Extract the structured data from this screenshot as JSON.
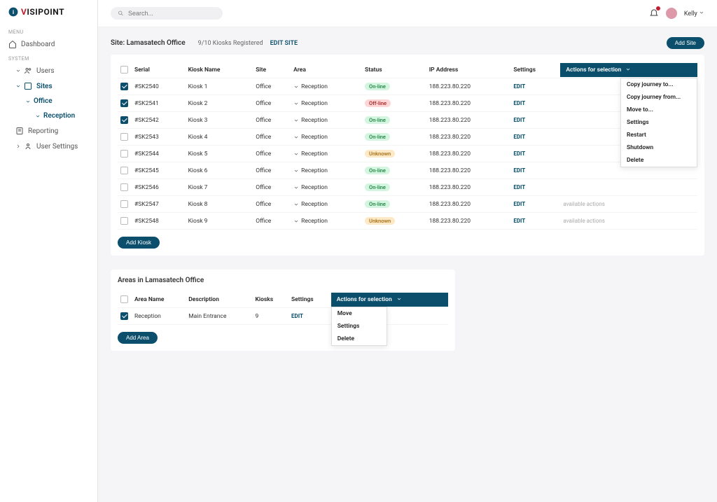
{
  "brand": {
    "v": "V",
    "rest": "ISIPOINT"
  },
  "topbar": {
    "search_placeholder": "Search...",
    "user_name": "Kelly"
  },
  "sidebar": {
    "menu_label": "MENU",
    "system_label": "SYSTEM",
    "dashboard": "Dashboard",
    "users": "Users",
    "sites": "Sites",
    "office": "Office",
    "reception": "Reception",
    "reporting": "Reporting",
    "user_settings": "User Settings"
  },
  "site": {
    "name": "Site: Lamasatech Office",
    "kiosk_count": "9/10 Kiosks Registered",
    "edit_site": "EDIT SITE",
    "add_site": "Add Site"
  },
  "kiosk_table": {
    "headers": {
      "serial": "Serial",
      "kiosk_name": "Kiosk Name",
      "site": "Site",
      "area": "Area",
      "status": "Status",
      "ip": "IP Address",
      "settings": "Settings",
      "actions_head": "Actions for selection"
    },
    "rows": [
      {
        "checked": true,
        "serial": "#SK2540",
        "name": "Kiosk 1",
        "site": "Office",
        "area": "Reception",
        "status": "On-line",
        "status_class": "online",
        "ip": "188.223.80.220"
      },
      {
        "checked": true,
        "serial": "#SK2541",
        "name": "Kiosk 2",
        "site": "Office",
        "area": "Reception",
        "status": "Off-line",
        "status_class": "offline",
        "ip": "188.223.80.220"
      },
      {
        "checked": true,
        "serial": "#SK2542",
        "name": "Kiosk 3",
        "site": "Office",
        "area": "Reception",
        "status": "On-line",
        "status_class": "online",
        "ip": "188.223.80.220"
      },
      {
        "checked": false,
        "serial": "#SK2543",
        "name": "Kiosk 4",
        "site": "Office",
        "area": "Reception",
        "status": "On-line",
        "status_class": "online",
        "ip": "188.223.80.220"
      },
      {
        "checked": false,
        "serial": "#SK2544",
        "name": "Kiosk 5",
        "site": "Office",
        "area": "Reception",
        "status": "Unknown",
        "status_class": "unknown",
        "ip": "188.223.80.220"
      },
      {
        "checked": false,
        "serial": "#SK2545",
        "name": "Kiosk 6",
        "site": "Office",
        "area": "Reception",
        "status": "On-line",
        "status_class": "online",
        "ip": "188.223.80.220"
      },
      {
        "checked": false,
        "serial": "#SK2546",
        "name": "Kiosk 7",
        "site": "Office",
        "area": "Reception",
        "status": "On-line",
        "status_class": "online",
        "ip": "188.223.80.220"
      },
      {
        "checked": false,
        "serial": "#SK2547",
        "name": "Kiosk 8",
        "site": "Office",
        "area": "Reception",
        "status": "On-line",
        "status_class": "online",
        "ip": "188.223.80.220"
      },
      {
        "checked": false,
        "serial": "#SK2548",
        "name": "Kiosk 9",
        "site": "Office",
        "area": "Reception",
        "status": "Unknown",
        "status_class": "unknown",
        "ip": "188.223.80.220"
      }
    ],
    "edit_label": "EDIT",
    "available_actions": "available actions",
    "add_kiosk": "Add Kiosk",
    "actions_menu": [
      "Copy journey to...",
      "Copy journey from...",
      "Move to...",
      "Settings",
      "Restart",
      "Shutdown",
      "Delete"
    ]
  },
  "areas": {
    "title": "Areas in Lamasatech Office",
    "headers": {
      "name": "Area Name",
      "description": "Description",
      "kiosks": "Kiosks",
      "settings": "Settings",
      "actions_head": "Actions for selection"
    },
    "rows": [
      {
        "checked": true,
        "name": "Reception",
        "description": "Main Entrance",
        "kiosks": "9"
      }
    ],
    "edit_label": "EDIT",
    "add_area": "Add Area",
    "actions_menu": [
      "Move",
      "Settings",
      "Delete"
    ]
  }
}
